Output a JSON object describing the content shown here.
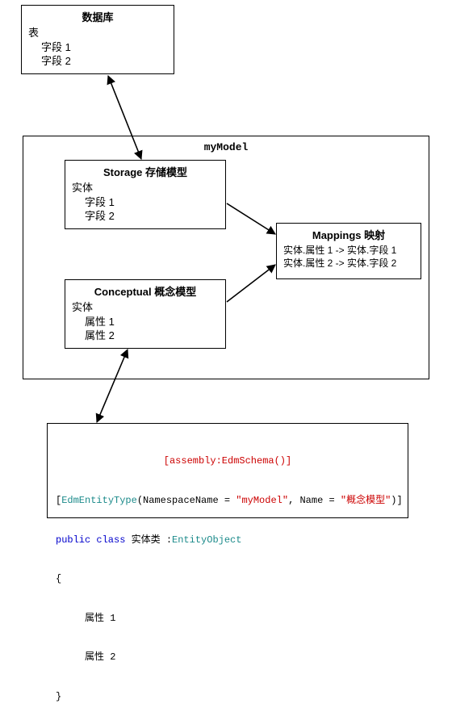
{
  "database": {
    "title": "数据库",
    "table": "表",
    "field1": "字段 1",
    "field2": "字段 2"
  },
  "model": {
    "title": "myModel",
    "storage": {
      "title": "Storage  存储模型",
      "entity": "实体",
      "field1": "字段 1",
      "field2": "字段 2"
    },
    "conceptual": {
      "title": "Conceptual  概念模型",
      "entity": "实体",
      "prop1": "属性 1",
      "prop2": "属性 2"
    },
    "mappings": {
      "title": "Mappings  映射",
      "line1": "实体.属性 1 -> 实体.字段 1",
      "line2": "实体.属性 2 -> 实体.字段 2"
    }
  },
  "code": {
    "attr_assembly": "[assembly:EdmSchema()]",
    "attr_open": "[",
    "attr_type": "EdmEntityType",
    "attr_paren_open": "(NamespaceName = ",
    "str_model": "\"myModel\"",
    "comma_name": ", Name = ",
    "str_name": "\"概念模型\"",
    "attr_paren_close": ")]",
    "kw_public_class": "public class ",
    "class_name": "实体类 ",
    "colon": ":",
    "base_type": "EntityObject",
    "brace_open": "{",
    "prop1": "属性 1",
    "prop2": "属性 2",
    "brace_close": "}"
  },
  "chart_data": {
    "type": "diagram",
    "nodes": [
      {
        "id": "database",
        "label": "数据库",
        "fields": [
          "表",
          "字段 1",
          "字段 2"
        ]
      },
      {
        "id": "myModel",
        "label": "myModel",
        "children": [
          "storage",
          "conceptual",
          "mappings"
        ]
      },
      {
        "id": "storage",
        "label": "Storage 存储模型",
        "fields": [
          "实体",
          "字段 1",
          "字段 2"
        ]
      },
      {
        "id": "conceptual",
        "label": "Conceptual 概念模型",
        "fields": [
          "实体",
          "属性 1",
          "属性 2"
        ]
      },
      {
        "id": "mappings",
        "label": "Mappings 映射",
        "fields": [
          "实体.属性 1 -> 实体.字段 1",
          "实体.属性 2 -> 实体.字段 2"
        ]
      },
      {
        "id": "code",
        "label": "[assembly:EdmSchema()] / EdmEntityType / public class 实体类 : EntityObject"
      }
    ],
    "edges": [
      {
        "from": "storage",
        "to": "database",
        "dir": "both"
      },
      {
        "from": "storage",
        "to": "mappings",
        "dir": "to"
      },
      {
        "from": "conceptual",
        "to": "mappings",
        "dir": "to"
      },
      {
        "from": "conceptual",
        "to": "code",
        "dir": "both"
      }
    ]
  }
}
